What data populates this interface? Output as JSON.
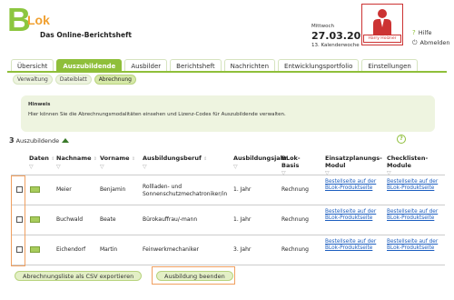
{
  "header": {
    "logo_letters": "BLok",
    "logo_subtitle": "Das Online-Berichtsheft",
    "weekday": "Mittwoch",
    "date": "27.03.2024",
    "week": "13. Kalenderwoche",
    "user_name": "Harry Holzner",
    "help_label": "Hilfe",
    "logout_label": "Abmelden"
  },
  "tabs": [
    {
      "label": "Übersicht",
      "active": false
    },
    {
      "label": "Auszubildende",
      "active": true
    },
    {
      "label": "Ausbilder",
      "active": false
    },
    {
      "label": "Berichtsheft",
      "active": false
    },
    {
      "label": "Nachrichten",
      "active": false
    },
    {
      "label": "Entwicklungsportfolio",
      "active": false
    },
    {
      "label": "Einstellungen",
      "active": false
    }
  ],
  "subtabs": [
    {
      "label": "Verwaltung",
      "active": false
    },
    {
      "label": "Dateiblatt",
      "active": false
    },
    {
      "label": "Abrechnung",
      "active": true
    }
  ],
  "hint": {
    "title": "Hinweis",
    "text": "Hier können Sie die Abrechnungsmodalitäten einsehen und Lizenz-Codes für Auszubildende verwalten."
  },
  "count": {
    "number": "3",
    "label": "Auszubildende"
  },
  "table": {
    "headers": {
      "daten": "Daten",
      "nachname": "Nachname",
      "vorname": "Vorname",
      "beruf": "Ausbildungsberuf",
      "jahr": "Ausbildungsjahr",
      "basis": "BLok-Basis",
      "einsatz": "Einsatzplanungs-Modul",
      "checkliste": "Checklisten-Module"
    },
    "rows": [
      {
        "nachname": "Meier",
        "vorname": "Benjamin",
        "beruf": "Rollladen- und Sonnenschutzmechatroniker/in",
        "jahr": "1. Jahr",
        "basis": "Rechnung",
        "einsatz": "Bestellseite auf der BLok-Produktseite",
        "checkliste": "Bestellseite auf der BLok-Produktseite"
      },
      {
        "nachname": "Buchwald",
        "vorname": "Beate",
        "beruf": "Bürokauffrau/-mann",
        "jahr": "1. Jahr",
        "basis": "Rechnung",
        "einsatz": "Bestellseite auf der BLok-Produktseite",
        "checkliste": "Bestellseite auf der BLok-Produktseite"
      },
      {
        "nachname": "Eichendorf",
        "vorname": "Martin",
        "beruf": "Feinwerkmechaniker",
        "jahr": "3. Jahr",
        "basis": "Rechnung",
        "einsatz": "Bestellseite auf der BLok-Produktseite",
        "checkliste": "Bestellseite auf der BLok-Produktseite"
      }
    ]
  },
  "footer": {
    "export_label": "Abrechnungsliste als CSV exportieren",
    "end_label": "Ausbildung beenden"
  },
  "colors": {
    "accent": "#8fbf3a",
    "highlight": "#f0a060",
    "link": "#1d5fc0"
  }
}
